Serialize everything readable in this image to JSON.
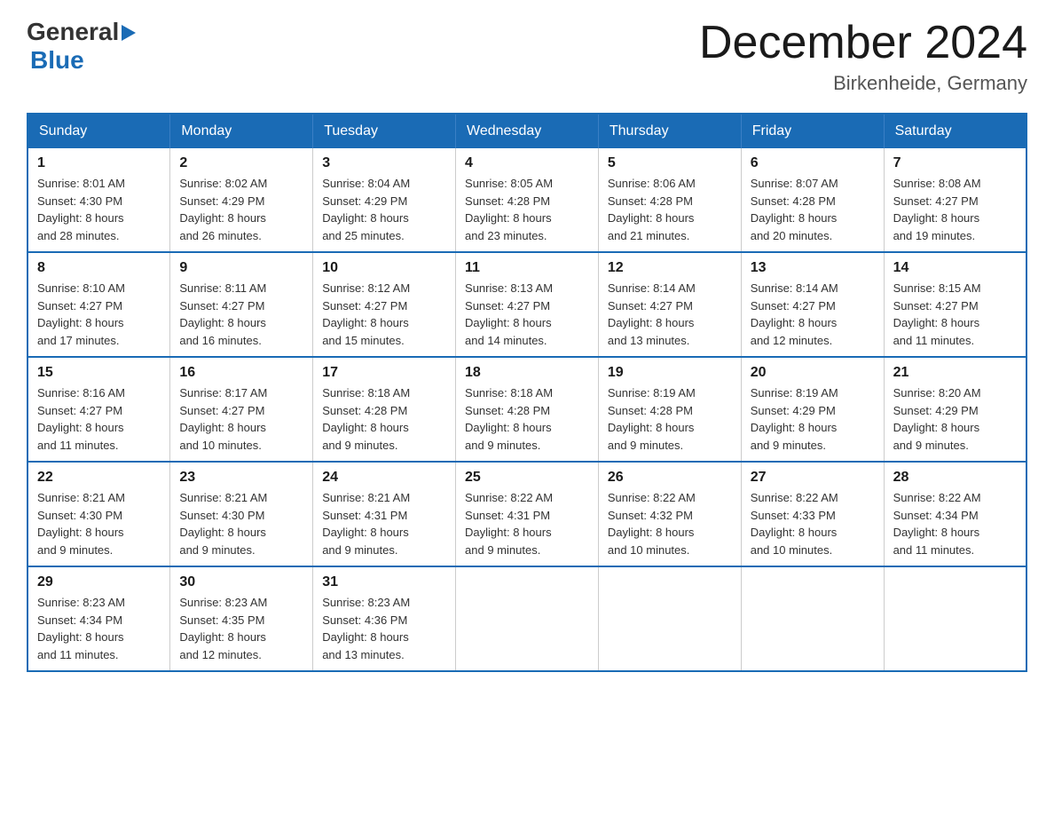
{
  "logo": {
    "text_general": "General",
    "text_blue": "Blue",
    "arrow": "▶"
  },
  "title": {
    "month_year": "December 2024",
    "location": "Birkenheide, Germany"
  },
  "headers": [
    "Sunday",
    "Monday",
    "Tuesday",
    "Wednesday",
    "Thursday",
    "Friday",
    "Saturday"
  ],
  "weeks": [
    [
      {
        "day": "1",
        "sunrise": "8:01 AM",
        "sunset": "4:30 PM",
        "daylight": "8 hours and 28 minutes."
      },
      {
        "day": "2",
        "sunrise": "8:02 AM",
        "sunset": "4:29 PM",
        "daylight": "8 hours and 26 minutes."
      },
      {
        "day": "3",
        "sunrise": "8:04 AM",
        "sunset": "4:29 PM",
        "daylight": "8 hours and 25 minutes."
      },
      {
        "day": "4",
        "sunrise": "8:05 AM",
        "sunset": "4:28 PM",
        "daylight": "8 hours and 23 minutes."
      },
      {
        "day": "5",
        "sunrise": "8:06 AM",
        "sunset": "4:28 PM",
        "daylight": "8 hours and 21 minutes."
      },
      {
        "day": "6",
        "sunrise": "8:07 AM",
        "sunset": "4:28 PM",
        "daylight": "8 hours and 20 minutes."
      },
      {
        "day": "7",
        "sunrise": "8:08 AM",
        "sunset": "4:27 PM",
        "daylight": "8 hours and 19 minutes."
      }
    ],
    [
      {
        "day": "8",
        "sunrise": "8:10 AM",
        "sunset": "4:27 PM",
        "daylight": "8 hours and 17 minutes."
      },
      {
        "day": "9",
        "sunrise": "8:11 AM",
        "sunset": "4:27 PM",
        "daylight": "8 hours and 16 minutes."
      },
      {
        "day": "10",
        "sunrise": "8:12 AM",
        "sunset": "4:27 PM",
        "daylight": "8 hours and 15 minutes."
      },
      {
        "day": "11",
        "sunrise": "8:13 AM",
        "sunset": "4:27 PM",
        "daylight": "8 hours and 14 minutes."
      },
      {
        "day": "12",
        "sunrise": "8:14 AM",
        "sunset": "4:27 PM",
        "daylight": "8 hours and 13 minutes."
      },
      {
        "day": "13",
        "sunrise": "8:14 AM",
        "sunset": "4:27 PM",
        "daylight": "8 hours and 12 minutes."
      },
      {
        "day": "14",
        "sunrise": "8:15 AM",
        "sunset": "4:27 PM",
        "daylight": "8 hours and 11 minutes."
      }
    ],
    [
      {
        "day": "15",
        "sunrise": "8:16 AM",
        "sunset": "4:27 PM",
        "daylight": "8 hours and 11 minutes."
      },
      {
        "day": "16",
        "sunrise": "8:17 AM",
        "sunset": "4:27 PM",
        "daylight": "8 hours and 10 minutes."
      },
      {
        "day": "17",
        "sunrise": "8:18 AM",
        "sunset": "4:28 PM",
        "daylight": "8 hours and 9 minutes."
      },
      {
        "day": "18",
        "sunrise": "8:18 AM",
        "sunset": "4:28 PM",
        "daylight": "8 hours and 9 minutes."
      },
      {
        "day": "19",
        "sunrise": "8:19 AM",
        "sunset": "4:28 PM",
        "daylight": "8 hours and 9 minutes."
      },
      {
        "day": "20",
        "sunrise": "8:19 AM",
        "sunset": "4:29 PM",
        "daylight": "8 hours and 9 minutes."
      },
      {
        "day": "21",
        "sunrise": "8:20 AM",
        "sunset": "4:29 PM",
        "daylight": "8 hours and 9 minutes."
      }
    ],
    [
      {
        "day": "22",
        "sunrise": "8:21 AM",
        "sunset": "4:30 PM",
        "daylight": "8 hours and 9 minutes."
      },
      {
        "day": "23",
        "sunrise": "8:21 AM",
        "sunset": "4:30 PM",
        "daylight": "8 hours and 9 minutes."
      },
      {
        "day": "24",
        "sunrise": "8:21 AM",
        "sunset": "4:31 PM",
        "daylight": "8 hours and 9 minutes."
      },
      {
        "day": "25",
        "sunrise": "8:22 AM",
        "sunset": "4:31 PM",
        "daylight": "8 hours and 9 minutes."
      },
      {
        "day": "26",
        "sunrise": "8:22 AM",
        "sunset": "4:32 PM",
        "daylight": "8 hours and 10 minutes."
      },
      {
        "day": "27",
        "sunrise": "8:22 AM",
        "sunset": "4:33 PM",
        "daylight": "8 hours and 10 minutes."
      },
      {
        "day": "28",
        "sunrise": "8:22 AM",
        "sunset": "4:34 PM",
        "daylight": "8 hours and 11 minutes."
      }
    ],
    [
      {
        "day": "29",
        "sunrise": "8:23 AM",
        "sunset": "4:34 PM",
        "daylight": "8 hours and 11 minutes."
      },
      {
        "day": "30",
        "sunrise": "8:23 AM",
        "sunset": "4:35 PM",
        "daylight": "8 hours and 12 minutes."
      },
      {
        "day": "31",
        "sunrise": "8:23 AM",
        "sunset": "4:36 PM",
        "daylight": "8 hours and 13 minutes."
      },
      null,
      null,
      null,
      null
    ]
  ],
  "labels": {
    "sunrise": "Sunrise:",
    "sunset": "Sunset:",
    "daylight": "Daylight:"
  }
}
